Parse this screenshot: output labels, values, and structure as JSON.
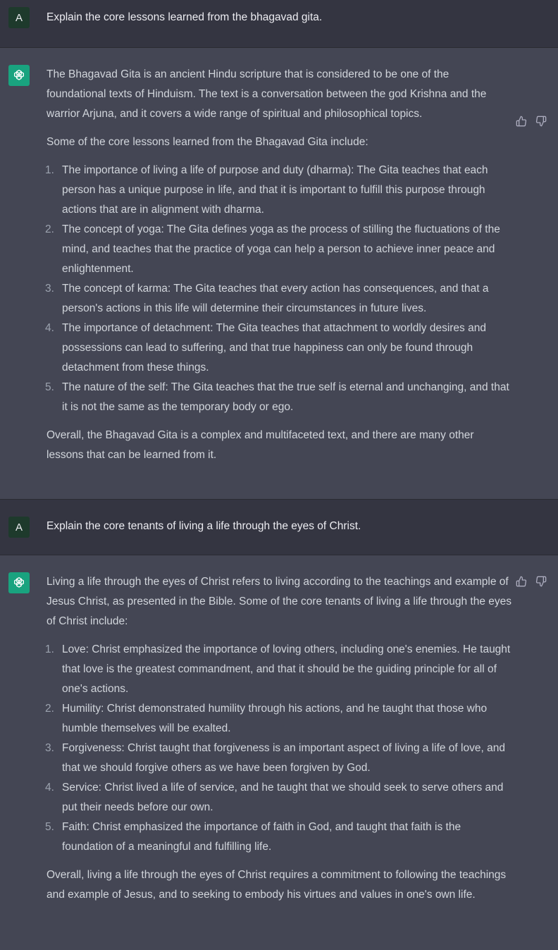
{
  "user_initial": "A",
  "messages": [
    {
      "role": "user",
      "text": "Explain the core lessons learned from the bhagavad gita."
    },
    {
      "role": "assistant",
      "intro": "The Bhagavad Gita is an ancient Hindu scripture that is considered to be one of the foundational texts of Hinduism. The text is a conversation between the god Krishna and the warrior Arjuna, and it covers a wide range of spiritual and philosophical topics.",
      "lead": "Some of the core lessons learned from the Bhagavad Gita include:",
      "items": [
        {
          "num": "1.",
          "text": "The importance of living a life of purpose and duty (dharma): The Gita teaches that each person has a unique purpose in life, and that it is important to fulfill this purpose through actions that are in alignment with dharma."
        },
        {
          "num": "2.",
          "text": "The concept of yoga: The Gita defines yoga as the process of stilling the fluctuations of the mind, and teaches that the practice of yoga can help a person to achieve inner peace and enlightenment."
        },
        {
          "num": "3.",
          "text": "The concept of karma: The Gita teaches that every action has consequences, and that a person's actions in this life will determine their circumstances in future lives."
        },
        {
          "num": "4.",
          "text": "The importance of detachment: The Gita teaches that attachment to worldly desires and possessions can lead to suffering, and that true happiness can only be found through detachment from these things."
        },
        {
          "num": "5.",
          "text": "The nature of the self: The Gita teaches that the true self is eternal and unchanging, and that it is not the same as the temporary body or ego."
        }
      ],
      "outro": "Overall, the Bhagavad Gita is a complex and multifaceted text, and there are many other lessons that can be learned from it."
    },
    {
      "role": "user",
      "text": "Explain the core tenants of living a life through the eyes of Christ."
    },
    {
      "role": "assistant",
      "intro": "Living a life through the eyes of Christ refers to living according to the teachings and example of Jesus Christ, as presented in the Bible. Some of the core tenants of living a life through the eyes of Christ include:",
      "items": [
        {
          "num": "1.",
          "text": "Love: Christ emphasized the importance of loving others, including one's enemies. He taught that love is the greatest commandment, and that it should be the guiding principle for all of one's actions."
        },
        {
          "num": "2.",
          "text": "Humility: Christ demonstrated humility through his actions, and he taught that those who humble themselves will be exalted."
        },
        {
          "num": "3.",
          "text": "Forgiveness: Christ taught that forgiveness is an important aspect of living a life of love, and that we should forgive others as we have been forgiven by God."
        },
        {
          "num": "4.",
          "text": "Service: Christ lived a life of service, and he taught that we should seek to serve others and put their needs before our own."
        },
        {
          "num": "5.",
          "text": "Faith: Christ emphasized the importance of faith in God, and taught that faith is the foundation of a meaningful and fulfilling life."
        }
      ],
      "outro": "Overall, living a life through the eyes of Christ requires a commitment to following the teachings and example of Jesus, and to seeking to embody his virtues and values in one's own life."
    }
  ],
  "icons": {
    "assistant_avatar": "openai-logo-icon",
    "like": "thumbs-up-icon",
    "dislike": "thumbs-down-icon"
  },
  "colors": {
    "user_bg": "#343541",
    "assistant_bg": "#444654",
    "avatar_user": "#1e3a2c",
    "avatar_assistant": "#19a37f"
  }
}
